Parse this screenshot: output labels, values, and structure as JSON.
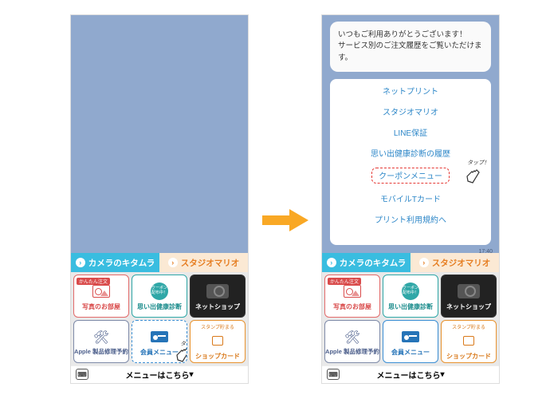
{
  "bubble": {
    "line1": "いつもご利用ありがとうございます！",
    "line2": "サービス別のご注文履歴をご覧いただけます。"
  },
  "links": {
    "items": [
      "ネットプリント",
      "スタジオマリオ",
      "LINE保証",
      "思い出健康診断の履歴",
      "クーポンメニュー",
      "モバイルTカード",
      "プリント利用規約へ"
    ],
    "dashed_index": 4,
    "timestamp": "17:40"
  },
  "tabs": {
    "left": "カメラのキタムラ",
    "right": "スタジオマリオ"
  },
  "tiles": [
    {
      "label": "写真のお部屋",
      "badge": "かんたん注文",
      "variant": "red"
    },
    {
      "label": "思い出健康診断",
      "bubble": "クーポン配布中！",
      "variant": "teal"
    },
    {
      "label": "ネットショップ",
      "variant": "dark"
    },
    {
      "label": "Apple 製品修理予約",
      "variant": "purple"
    },
    {
      "label": "会員メニュー",
      "variant": "blue"
    },
    {
      "label": "ショップカード",
      "sub": "スタンプ貯まる",
      "variant": "orange"
    }
  ],
  "footer": "メニューはこちら",
  "tap_label": "タップ！"
}
